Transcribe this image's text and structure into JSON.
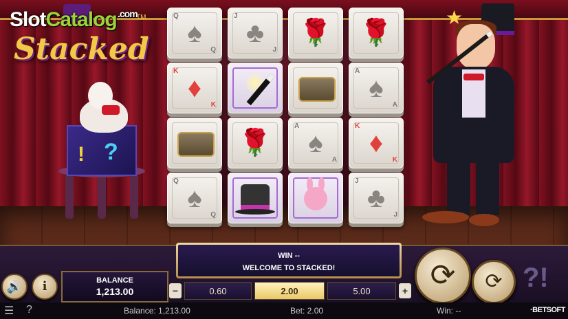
{
  "watermark": {
    "brand": "Slot",
    "brand_accent": "Catalog",
    "suffix": ".com"
  },
  "game": {
    "logo": "Stacked",
    "tm": "TM"
  },
  "reels": [
    [
      {
        "type": "card",
        "rank": "Q",
        "suit": "♠"
      },
      {
        "type": "card",
        "rank": "J",
        "suit": "♣"
      },
      {
        "type": "rose",
        "symbol": "🌹"
      },
      {
        "type": "rose",
        "symbol": "🌹"
      }
    ],
    [
      {
        "type": "diamond",
        "rank": "K",
        "suit": "♦"
      },
      {
        "type": "wand"
      },
      {
        "type": "chest"
      },
      {
        "type": "card",
        "rank": "A",
        "suit": "♠"
      }
    ],
    [
      {
        "type": "chest"
      },
      {
        "type": "rose",
        "symbol": "🌹"
      },
      {
        "type": "card",
        "rank": "A",
        "suit": "♠"
      },
      {
        "type": "diamond",
        "rank": "K",
        "suit": "♦"
      }
    ],
    [
      {
        "type": "card",
        "rank": "Q",
        "suit": "♠"
      },
      {
        "type": "tophat"
      },
      {
        "type": "bunny"
      },
      {
        "type": "card",
        "rank": "J",
        "suit": "♣"
      }
    ]
  ],
  "win_panel": {
    "win_label": "WIN",
    "win_value": "--",
    "message": "WELCOME TO STACKED!"
  },
  "balance": {
    "label": "BALANCE",
    "value": "1,213.00"
  },
  "bets": {
    "minus": "−",
    "plus": "+",
    "options": [
      "0.60",
      "2.00",
      "5.00"
    ],
    "selected_index": 1
  },
  "controls": {
    "sound_icon": "🔊",
    "info_icon": "i",
    "spin_icon": "⟳",
    "autoplay_icon": "⟳",
    "help_graphic": "?!"
  },
  "status": {
    "menu_icon": "☰",
    "help_icon": "?",
    "balance_text": "Balance: 1,213.00",
    "bet_text": "Bet: 2.00",
    "win_text": "Win: --",
    "provider": "·BETSOFT"
  }
}
